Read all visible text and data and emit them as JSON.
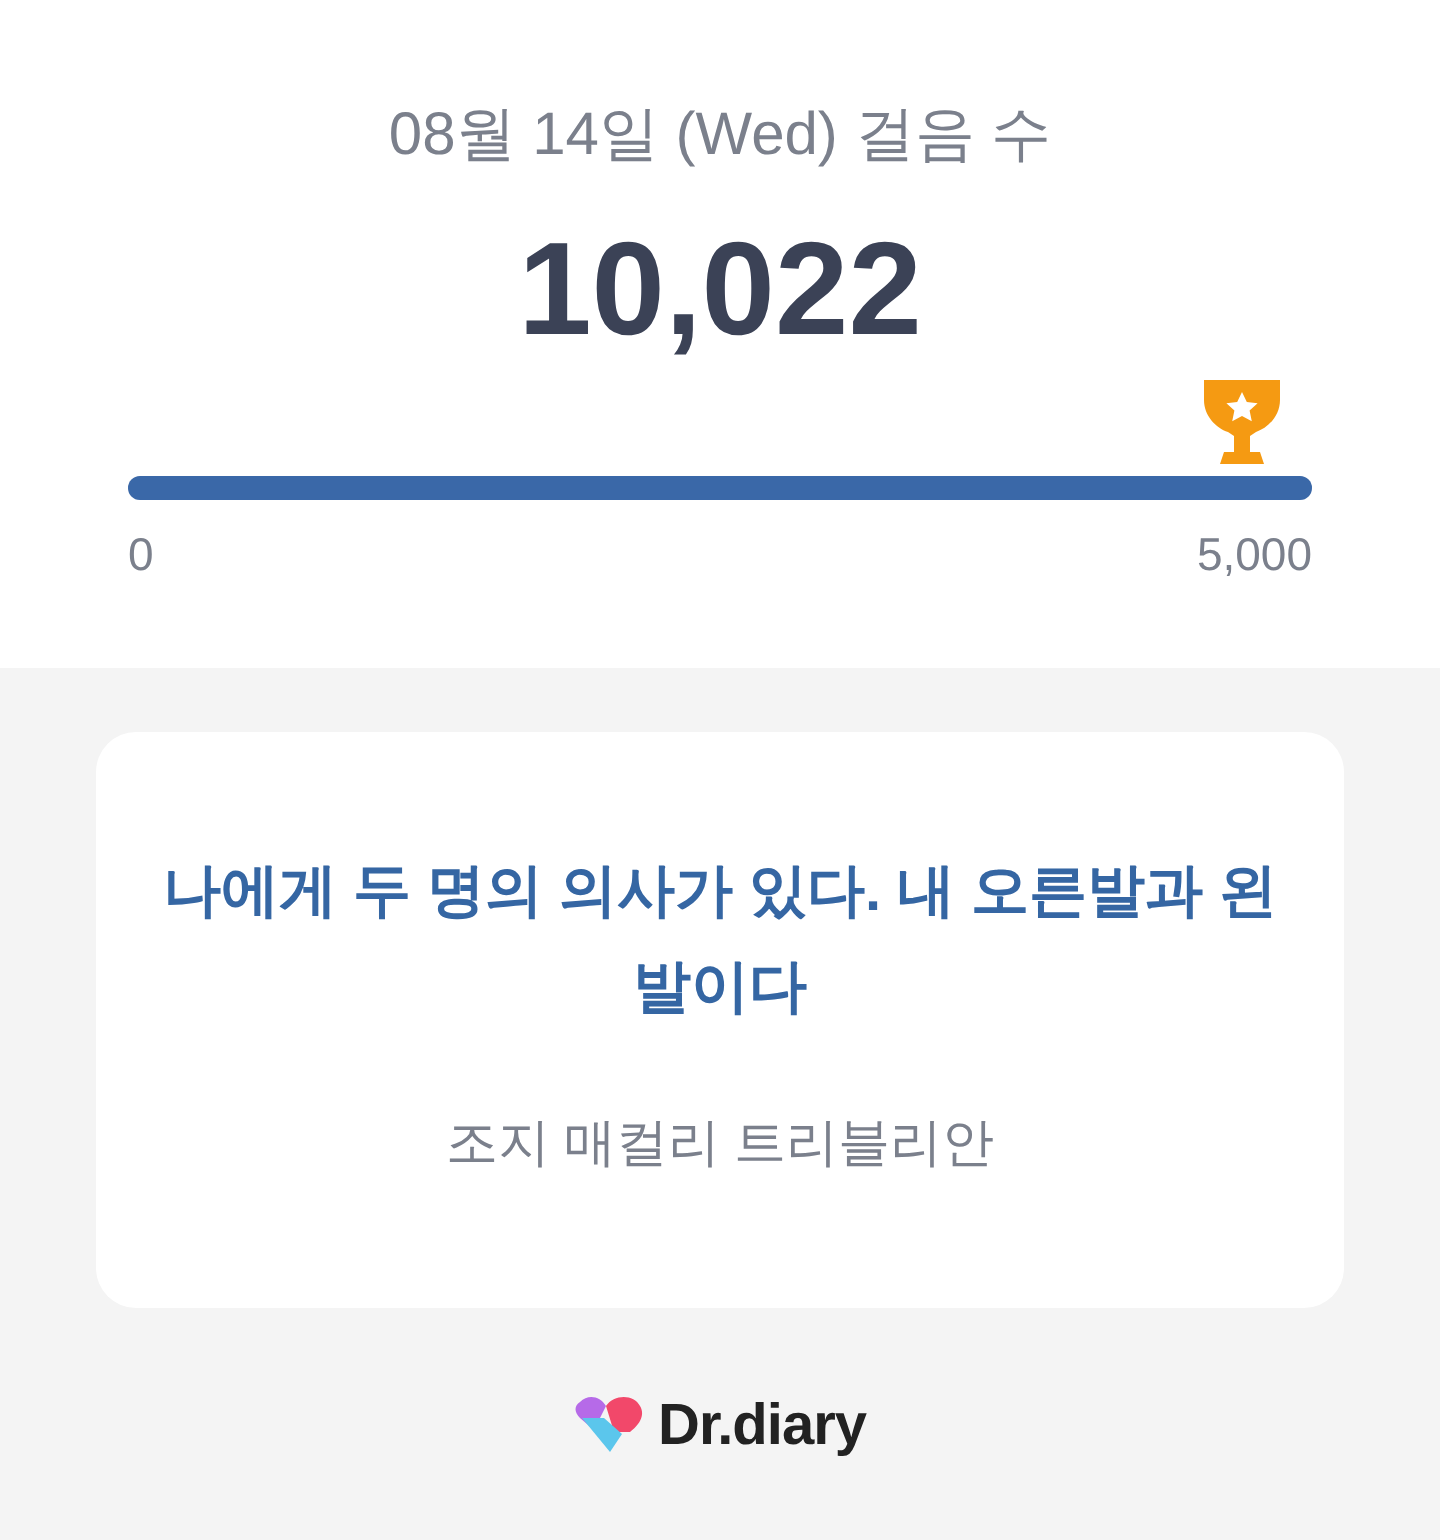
{
  "steps": {
    "title": "08월 14일 (Wed) 걸음 수",
    "count": "10,022",
    "goal": {
      "level": 1,
      "min_label": "0",
      "max_label": "5,000",
      "achieved": true
    }
  },
  "quote": {
    "text": "나에게 두 명의 의사가 있다. 내 오른발과 왼발이다",
    "author": "조지 매컬리 트리블리안"
  },
  "footer": {
    "brand": "Dr.diary"
  }
}
